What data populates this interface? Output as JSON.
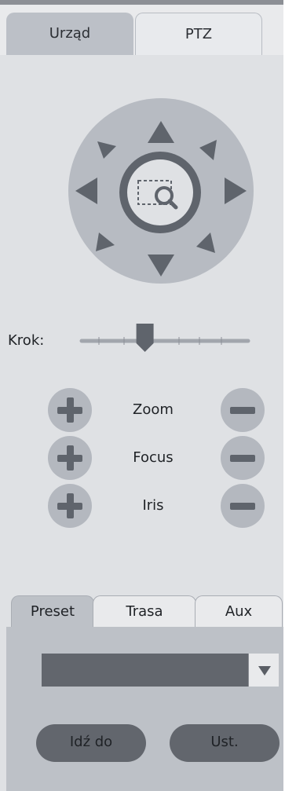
{
  "tabs": {
    "urzad": "Urząd",
    "ptz": "PTZ",
    "active": "PTZ"
  },
  "krok": {
    "label": "Krok:",
    "slider_position": 0.38
  },
  "controls": [
    {
      "label": "Zoom"
    },
    {
      "label": "Focus"
    },
    {
      "label": "Iris"
    }
  ],
  "sub_tabs": {
    "preset": "Preset",
    "trasa": "Trasa",
    "aux": "Aux",
    "active": "Preset"
  },
  "preset_panel": {
    "selected_value": "",
    "go_button": "Idź do",
    "set_button": "Ust."
  },
  "colors": {
    "ptz_disc": "#b7bbc2",
    "ptz_arrows": "#5f646c",
    "active_panel": "#bdc1c7"
  },
  "icons": {
    "center": "zoom-area-icon",
    "arrows": [
      "up-arrow-icon",
      "down-arrow-icon",
      "left-arrow-icon",
      "right-arrow-icon",
      "up-left-arrow-icon",
      "up-right-arrow-icon",
      "down-left-arrow-icon",
      "down-right-arrow-icon"
    ]
  }
}
